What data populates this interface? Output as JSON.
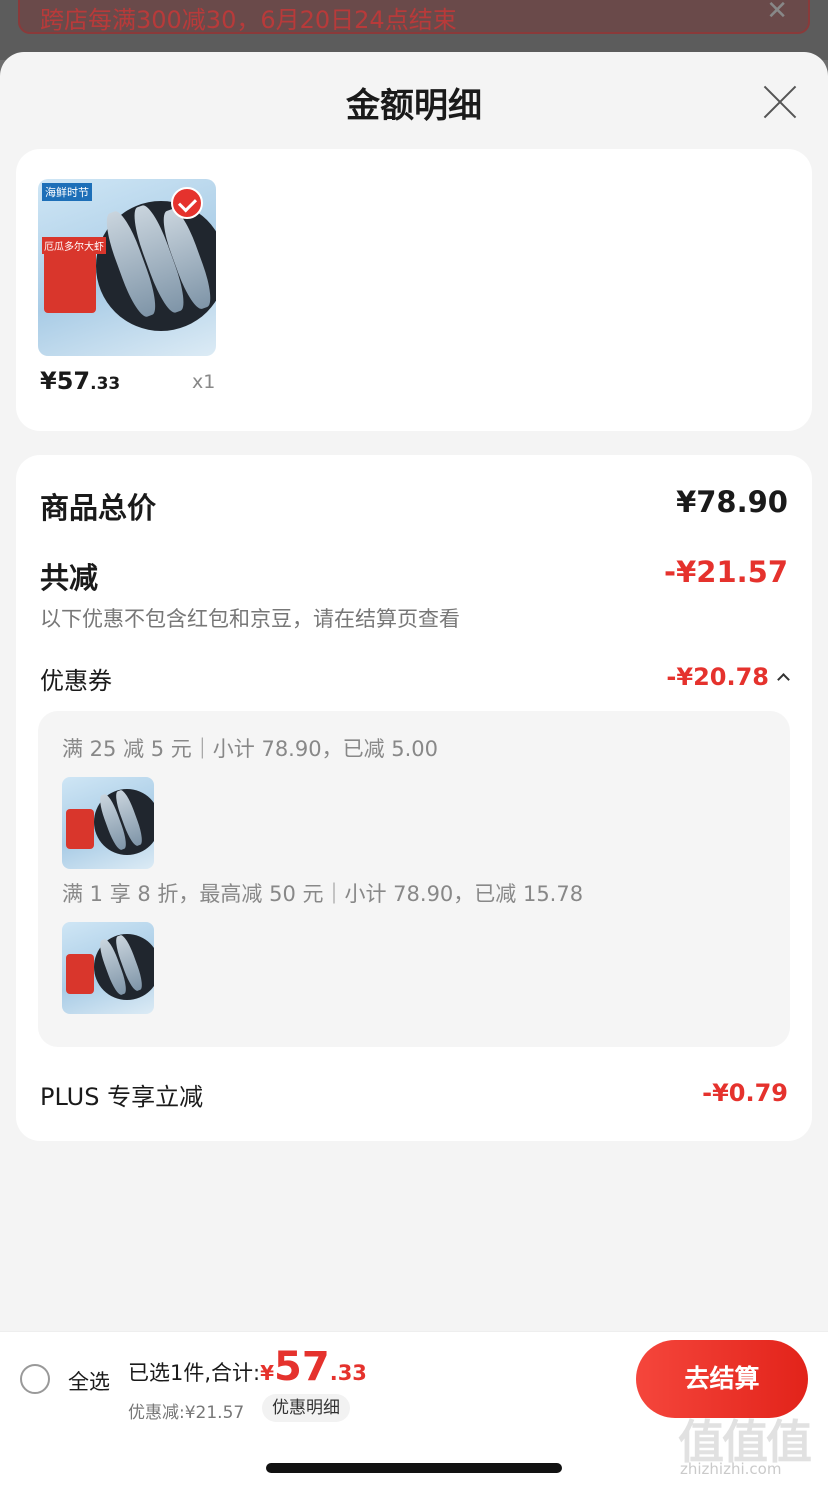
{
  "banner": {
    "text": "跨店每满300减30，6月20日24点结束"
  },
  "sheet": {
    "title": "金额明细"
  },
  "product": {
    "thumb_badge": "海鲜时节",
    "thumb_title": "厄瓜多尔大虾",
    "price_int": "¥57",
    "price_dec": ".33",
    "quantity": "x1"
  },
  "detail": {
    "total_label": "商品总价",
    "total_value": "¥78.90",
    "reduce_label": "共减",
    "reduce_value": "-¥21.57",
    "note": "以下优惠不包含红包和京豆，请在结算页查看",
    "coupon_label": "优惠券",
    "coupon_value": "-¥20.78",
    "coupon_items": [
      {
        "text": "满 25 减 5 元｜小计 78.90，已减 5.00"
      },
      {
        "text": "满 1 享 8 折，最高减 50 元｜小计 78.90，已减 15.78"
      }
    ],
    "plus_label": "PLUS 专享立减",
    "plus_value": "-¥0.79"
  },
  "bottom": {
    "select_all": "全选",
    "summary_prefix": "已选1件,合计:",
    "yen": "¥",
    "total_int": "57",
    "total_dec": ".33",
    "discount_text": "优惠减:¥21.57",
    "detail_chip": "优惠明细",
    "checkout": "去结算"
  },
  "watermark": {
    "logo": "值值值",
    "url": "zhizhizhi.com"
  },
  "colors": {
    "accent": "#e5322d",
    "sheet_bg": "#f4f4f4",
    "card_bg": "#ffffff"
  }
}
